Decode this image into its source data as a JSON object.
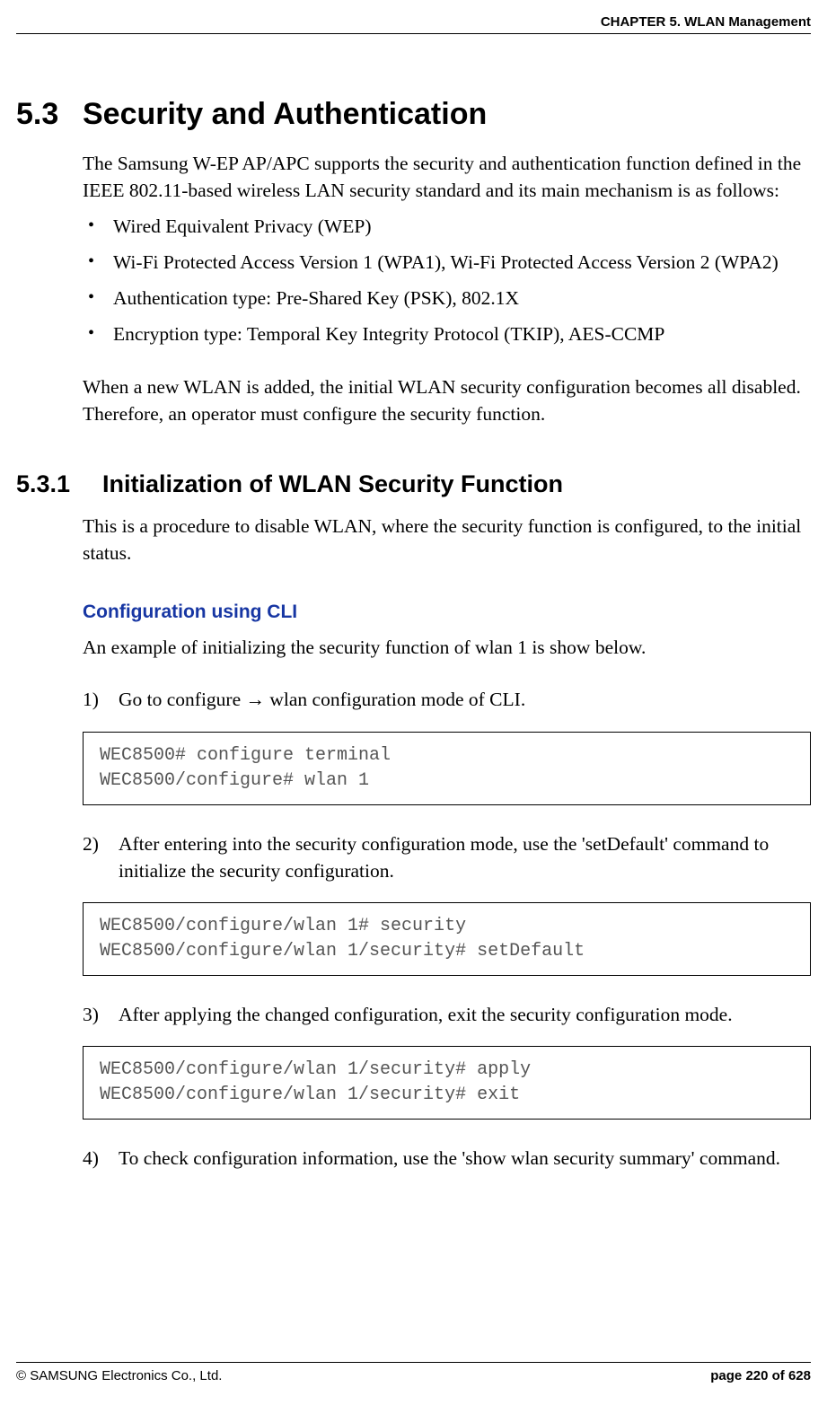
{
  "header": {
    "chapter": "CHAPTER 5. WLAN Management"
  },
  "section": {
    "number": "5.3",
    "title": "Security and Authentication",
    "intro": "The Samsung W-EP AP/APC supports the security and authentication function defined in the IEEE 802.11-based wireless LAN security standard and its main mechanism is as follows:",
    "bullets": [
      "Wired Equivalent Privacy (WEP)",
      "Wi-Fi Protected Access Version 1 (WPA1), Wi-Fi Protected Access Version 2 (WPA2)",
      "Authentication type: Pre-Shared Key (PSK), 802.1X",
      "Encryption type: Temporal Key Integrity Protocol (TKIP), AES-CCMP"
    ],
    "note": "When a new WLAN is added, the initial WLAN security configuration becomes all disabled. Therefore, an operator must configure the security function."
  },
  "subsection": {
    "number": "5.3.1",
    "title": "Initialization of WLAN Security Function",
    "intro": "This is a procedure to disable WLAN, where the security function is configured, to the initial status.",
    "cli_heading": "Configuration using CLI",
    "cli_intro": "An example of initializing the security function of wlan 1 is show below.",
    "steps": [
      {
        "num": "1)",
        "text_pre": "Go to configure ",
        "arrow": "→",
        "text_post": " wlan configuration mode of CLI."
      },
      {
        "num": "2)",
        "text": "After entering into the security configuration mode, use the 'setDefault' command to initialize the security configuration."
      },
      {
        "num": "3)",
        "text": "After applying the changed configuration, exit the security configuration mode."
      },
      {
        "num": "4)",
        "text": "To check configuration information, use the 'show wlan security summary' command."
      }
    ],
    "code": [
      "WEC8500# configure terminal\nWEC8500/configure# wlan 1",
      "WEC8500/configure/wlan 1# security\nWEC8500/configure/wlan 1/security# setDefault",
      "WEC8500/configure/wlan 1/security# apply\nWEC8500/configure/wlan 1/security# exit"
    ]
  },
  "footer": {
    "copyright": "© SAMSUNG Electronics Co., Ltd.",
    "page": "page 220 of 628"
  }
}
